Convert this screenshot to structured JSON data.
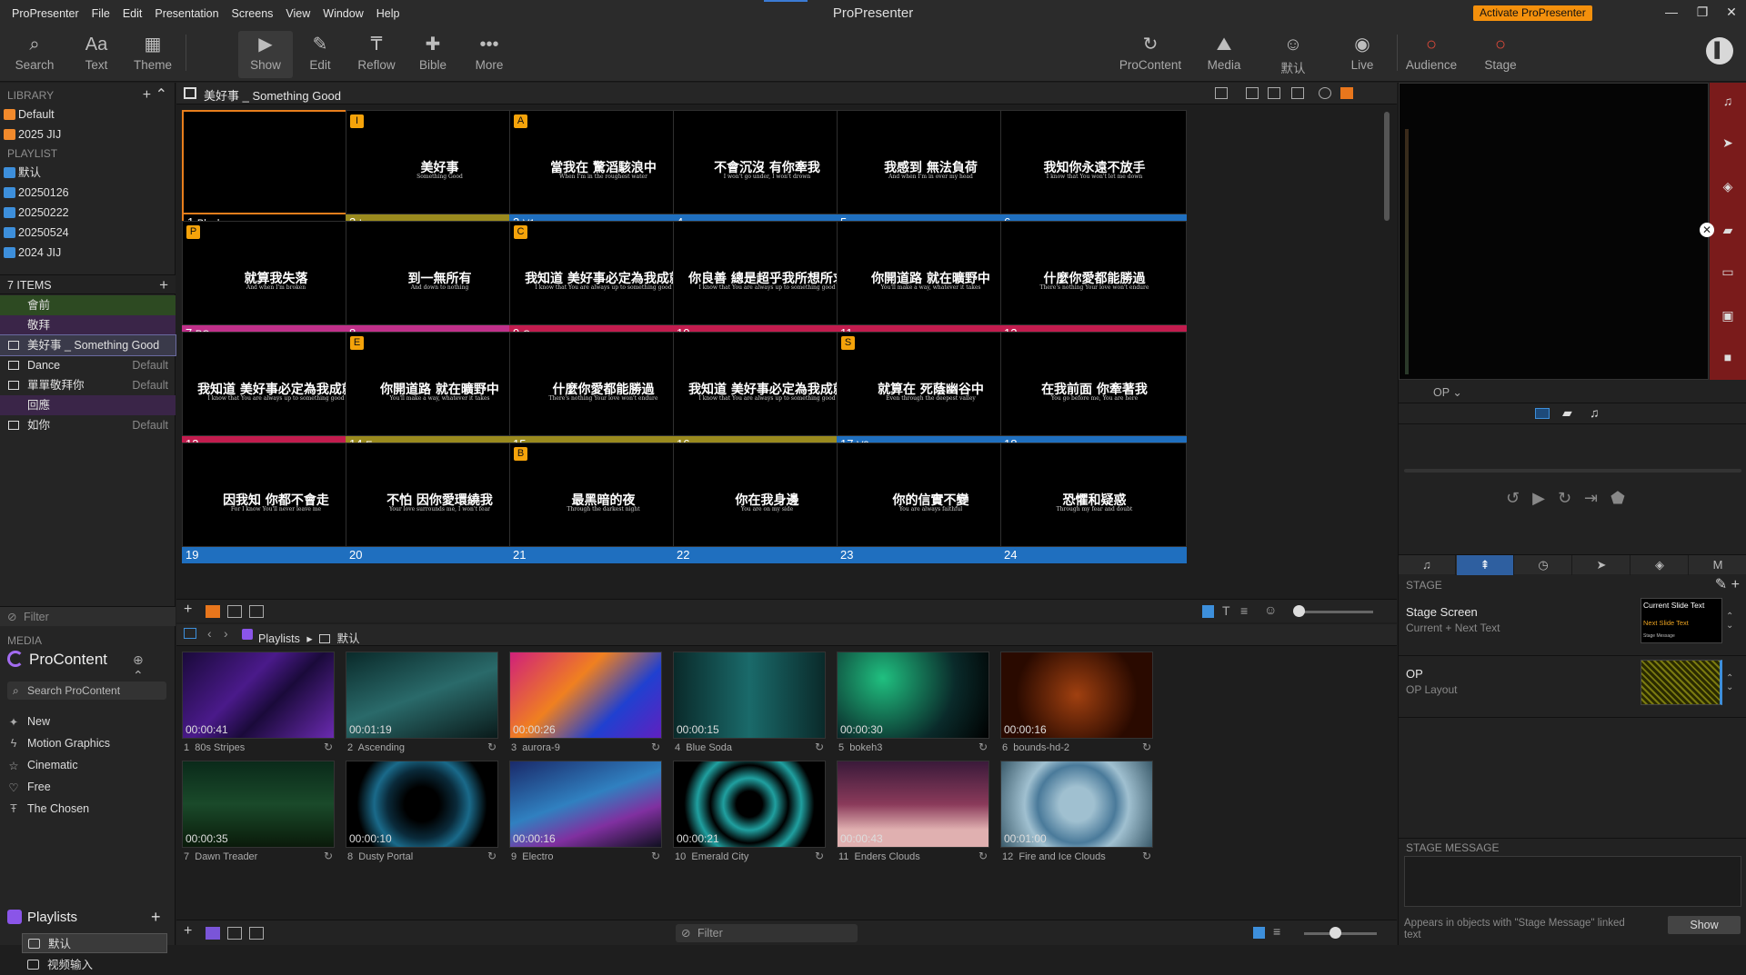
{
  "app": {
    "title": "ProPresenter",
    "menu": [
      "ProPresenter",
      "File",
      "Edit",
      "Presentation",
      "Screens",
      "View",
      "Window",
      "Help"
    ],
    "activate_label": "Activate ProPresenter"
  },
  "toolbar": {
    "search": "Search",
    "text": "Text",
    "theme": "Theme",
    "show": "Show",
    "edit": "Edit",
    "reflow": "Reflow",
    "bible": "Bible",
    "more": "More",
    "procontent": "ProContent",
    "media": "Media",
    "default": "默认",
    "live": "Live",
    "audience": "Audience",
    "stage": "Stage"
  },
  "library": {
    "header": "LIBRARY",
    "items": [
      "Default",
      "2025 JIJ"
    ],
    "playlist_header": "PLAYLIST",
    "playlists": [
      "默认",
      "20250126",
      "20250222",
      "20250524",
      "2024 JIJ"
    ]
  },
  "items": {
    "header": "7 ITEMS",
    "list": [
      {
        "label": "會前",
        "arr": "",
        "color": "#2d4a22"
      },
      {
        "label": "敬拜",
        "arr": "",
        "color": "#3a2548"
      },
      {
        "label": "美好事 _ Something Good",
        "arr": "",
        "color": "#3a3a4a"
      },
      {
        "label": "Dance",
        "arr": "Default",
        "color": ""
      },
      {
        "label": "單單敬拜你",
        "arr": "Default",
        "color": ""
      },
      {
        "label": "回應",
        "arr": "",
        "color": "#3a2548"
      },
      {
        "label": "如你",
        "arr": "Default",
        "color": ""
      }
    ],
    "filter": "Filter"
  },
  "media_panel": {
    "header": "MEDIA",
    "procontent": "ProContent",
    "search": "Search ProContent",
    "categories": [
      "New",
      "Motion Graphics",
      "Cinematic",
      "Free",
      "The Chosen"
    ],
    "playlists_label": "Playlists",
    "playlist_items": [
      "默认",
      "视频输入"
    ]
  },
  "presentation": {
    "title": "美好事 _ Something Good",
    "slides": [
      {
        "num": "1",
        "group": "Blank",
        "badge": "",
        "zh": "",
        "en": "",
        "color": "#000000"
      },
      {
        "num": "2",
        "group": "I",
        "badge": "I",
        "zh": "美好事",
        "en": "Something Good",
        "color": "#9a8a1e"
      },
      {
        "num": "3",
        "group": "V1",
        "badge": "A",
        "zh": "當我在 驚滔駭浪中",
        "en": "When I'm in the roughest water",
        "color": "#1f6fbf"
      },
      {
        "num": "4",
        "group": "",
        "badge": "",
        "zh": "不會沉沒 有你牽我",
        "en": "I won't go under, I won't drown",
        "color": "#1f6fbf"
      },
      {
        "num": "5",
        "group": "",
        "badge": "",
        "zh": "我感到 無法負荷",
        "en": "And when I'm in over my head",
        "color": "#1f6fbf"
      },
      {
        "num": "6",
        "group": "",
        "badge": "",
        "zh": "我知你永遠不放手",
        "en": "I know that You won't let me down",
        "color": "#1f6fbf"
      },
      {
        "num": "7",
        "group": "PC",
        "badge": "P",
        "zh": "就算我失落",
        "en": "And when I'm broken",
        "color": "#c0308a"
      },
      {
        "num": "8",
        "group": "",
        "badge": "",
        "zh": "到一無所有",
        "en": "And down to nothing",
        "color": "#c0308a"
      },
      {
        "num": "9",
        "group": "C",
        "badge": "C",
        "zh": "我知道 美好事必定為我成就",
        "en": "I know that You are always up to something good",
        "color": "#c21c4e"
      },
      {
        "num": "10",
        "group": "",
        "badge": "",
        "zh": "你良善 總是超乎我所想所求",
        "en": "I know that You are always up to something good",
        "color": "#c21c4e"
      },
      {
        "num": "11",
        "group": "",
        "badge": "",
        "zh": "你開道路 就在曠野中",
        "en": "You'll make a way, whatever it takes",
        "color": "#c21c4e"
      },
      {
        "num": "12",
        "group": "",
        "badge": "",
        "zh": "什麼你愛都能勝過",
        "en": "There's nothing Your love won't endure",
        "color": "#c21c4e"
      },
      {
        "num": "13",
        "group": "",
        "badge": "",
        "zh": "我知道 美好事必定為我成就",
        "en": "I know that You are always up to something good",
        "color": "#c21c4e"
      },
      {
        "num": "14",
        "group": "E",
        "badge": "E",
        "zh": "你開道路 就在曠野中",
        "en": "You'll make a way, whatever it takes",
        "color": "#9a8a1e"
      },
      {
        "num": "15",
        "group": "",
        "badge": "",
        "zh": "什麼你愛都能勝過",
        "en": "There's nothing Your love won't endure",
        "color": "#9a8a1e"
      },
      {
        "num": "16",
        "group": "",
        "badge": "",
        "zh": "我知道 美好事必定為我成就",
        "en": "I know that You are always up to something good",
        "color": "#9a8a1e"
      },
      {
        "num": "17",
        "group": "V2",
        "badge": "S",
        "zh": "就算在 死蔭幽谷中",
        "en": "Even through the deepest valley",
        "color": "#1f6fbf"
      },
      {
        "num": "18",
        "group": "",
        "badge": "",
        "zh": "在我前面 你牽著我",
        "en": "You go before me, You are here",
        "color": "#1f6fbf"
      },
      {
        "num": "19",
        "group": "",
        "badge": "",
        "zh": "因我知 你都不會走",
        "en": "For I know You'll never leave me",
        "color": "#1f6fbf"
      },
      {
        "num": "20",
        "group": "",
        "badge": "",
        "zh": "不怕 因你愛環繞我",
        "en": "Your love surrounds me, I won't fear",
        "color": "#1f6fbf"
      },
      {
        "num": "21",
        "group": "",
        "badge": "B",
        "zh": "最黑暗的夜",
        "en": "Through the darkest night",
        "color": "#1f6fbf"
      },
      {
        "num": "22",
        "group": "",
        "badge": "",
        "zh": "你在我身邊",
        "en": "You are on my side",
        "color": "#1f6fbf"
      },
      {
        "num": "23",
        "group": "",
        "badge": "",
        "zh": "你的信實不變",
        "en": "You are always faithful",
        "color": "#1f6fbf"
      },
      {
        "num": "24",
        "group": "",
        "badge": "",
        "zh": "恐懼和疑惑",
        "en": "Through my fear and doubt",
        "color": "#1f6fbf"
      }
    ]
  },
  "media_browser": {
    "breadcrumb_root": "Playlists",
    "breadcrumb_current": "默认",
    "filter": "Filter",
    "tiles": [
      {
        "num": "1",
        "name": "80s Stripes",
        "dur": "00:00:41",
        "bg": "linear-gradient(135deg,#1a0a3a,#4a1a8a 40%,#1a0a3a 60%,#6a2ab0)"
      },
      {
        "num": "2",
        "name": "Ascending",
        "dur": "00:01:19",
        "bg": "linear-gradient(160deg,#0a2a2a,#2a6a6a 50%,#0a1a1a)"
      },
      {
        "num": "3",
        "name": "aurora-9",
        "dur": "00:00:26",
        "bg": "linear-gradient(135deg,#d0207a,#f08020 40%,#2040d0 70%,#6020c0)"
      },
      {
        "num": "4",
        "name": "Blue Soda",
        "dur": "00:00:15",
        "bg": "linear-gradient(90deg,#0a2a2a,#1a6a6a 50%,#0a2a2a)"
      },
      {
        "num": "5",
        "name": "bokeh3",
        "dur": "00:00:30",
        "bg": "radial-gradient(circle at 30% 30%,#20c080,#0a2a2a 60%,#000)"
      },
      {
        "num": "6",
        "name": "bounds-hd-2",
        "dur": "00:00:16",
        "bg": "radial-gradient(circle,#a04010,#2a0a00 70%)"
      },
      {
        "num": "7",
        "name": "Dawn Treader",
        "dur": "00:00:35",
        "bg": "linear-gradient(180deg,#0a2a1a,#1a4a2a 50%,#0a1a0a)"
      },
      {
        "num": "8",
        "name": "Dusty Portal",
        "dur": "00:00:10",
        "bg": "radial-gradient(circle,#000 20%,#0a2a3a 40%,#1a6a8a 55%,#000 75%)"
      },
      {
        "num": "9",
        "name": "Electro",
        "dur": "00:00:16",
        "bg": "linear-gradient(160deg,#1a2a6a,#3080c0 45%,#8030a0 70%,#101020)"
      },
      {
        "num": "10",
        "name": "Emerald City",
        "dur": "00:00:21",
        "bg": "radial-gradient(circle,#000 15%,#20a0a0 30%,#000 45%,#20a0a0 60%,#000 75%)"
      },
      {
        "num": "11",
        "name": "Enders Clouds",
        "dur": "00:00:43",
        "bg": "linear-gradient(180deg,#3a1a3a,#8a3a5a 50%,#e0b0b0 80%)"
      },
      {
        "num": "12",
        "name": "Fire and Ice Clouds",
        "dur": "00:01:00",
        "bg": "radial-gradient(circle,#a0c0d0 20%,#4a7a9a 45%,#a0c0d0 60%,#3a5a6a)"
      }
    ]
  },
  "right_panel": {
    "op_label": "OP",
    "stage_header": "STAGE",
    "stage_rows": [
      {
        "title": "Stage Screen",
        "sub": "Current + Next Text",
        "thumb_a": "Current Slide Text",
        "thumb_b": "Next Slide Text",
        "thumb_c": "Stage Message"
      },
      {
        "title": "OP",
        "sub": "OP Layout"
      }
    ],
    "stage_msg_header": "STAGE MESSAGE",
    "stage_msg_note": "Appears in objects with \"Stage Message\" linked text",
    "show_label": "Show"
  }
}
